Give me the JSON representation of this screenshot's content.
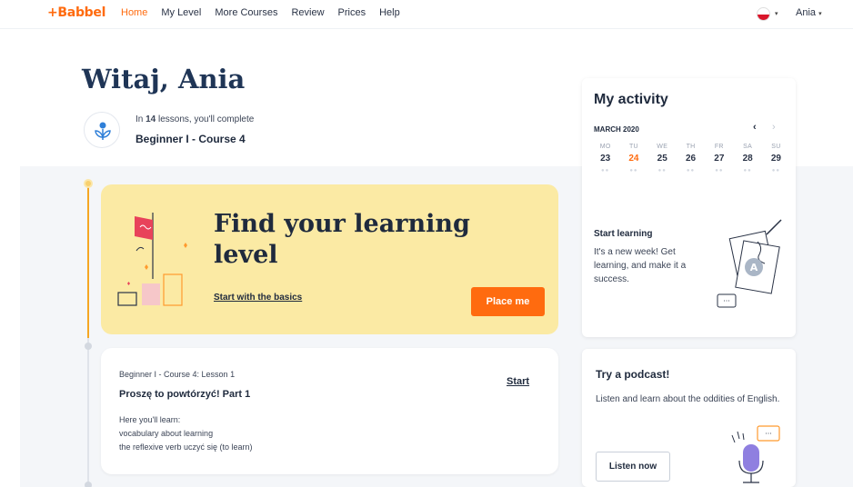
{
  "nav": {
    "logo": "+Babbel",
    "links": [
      "Home",
      "My Level",
      "More Courses",
      "Review",
      "Prices",
      "Help"
    ],
    "active": "Home",
    "user": "Ania",
    "caret": "▾"
  },
  "hero": {
    "greeting": "Witaj, Ania",
    "lessons_prefix": "In ",
    "lessons_count": "14",
    "lessons_suffix": " lessons, you'll complete",
    "course": "Beginner I - Course 4"
  },
  "level_card": {
    "title": "Find your learning level",
    "link": "Start with the basics",
    "button": "Place me"
  },
  "lesson": {
    "course": "Beginner I - Course 4: Lesson 1",
    "title": "Proszę to powtórzyć! Part 1",
    "start": "Start",
    "learn_heading": "Here you'll learn:",
    "learn_items": [
      "vocabulary about learning",
      "the reflexive verb uczyć się (to learn)"
    ]
  },
  "activity": {
    "title": "My activity",
    "month": "MARCH 2020",
    "prev": "‹",
    "next": "›",
    "days": [
      {
        "name": "MO",
        "date": "23"
      },
      {
        "name": "TU",
        "date": "24"
      },
      {
        "name": "WE",
        "date": "25"
      },
      {
        "name": "TH",
        "date": "26"
      },
      {
        "name": "FR",
        "date": "27"
      },
      {
        "name": "SA",
        "date": "28"
      },
      {
        "name": "SU",
        "date": "29"
      }
    ],
    "today": "24",
    "start_title": "Start learning",
    "start_text": "It's a new week! Get learning, and make it a success."
  },
  "podcast": {
    "title": "Try a podcast!",
    "text": "Listen and learn about the oddities of English.",
    "button": "Listen now"
  },
  "colors": {
    "accent": "#ff6b0f",
    "card_yellow": "#fbeaa4",
    "navy": "#1f3556"
  }
}
